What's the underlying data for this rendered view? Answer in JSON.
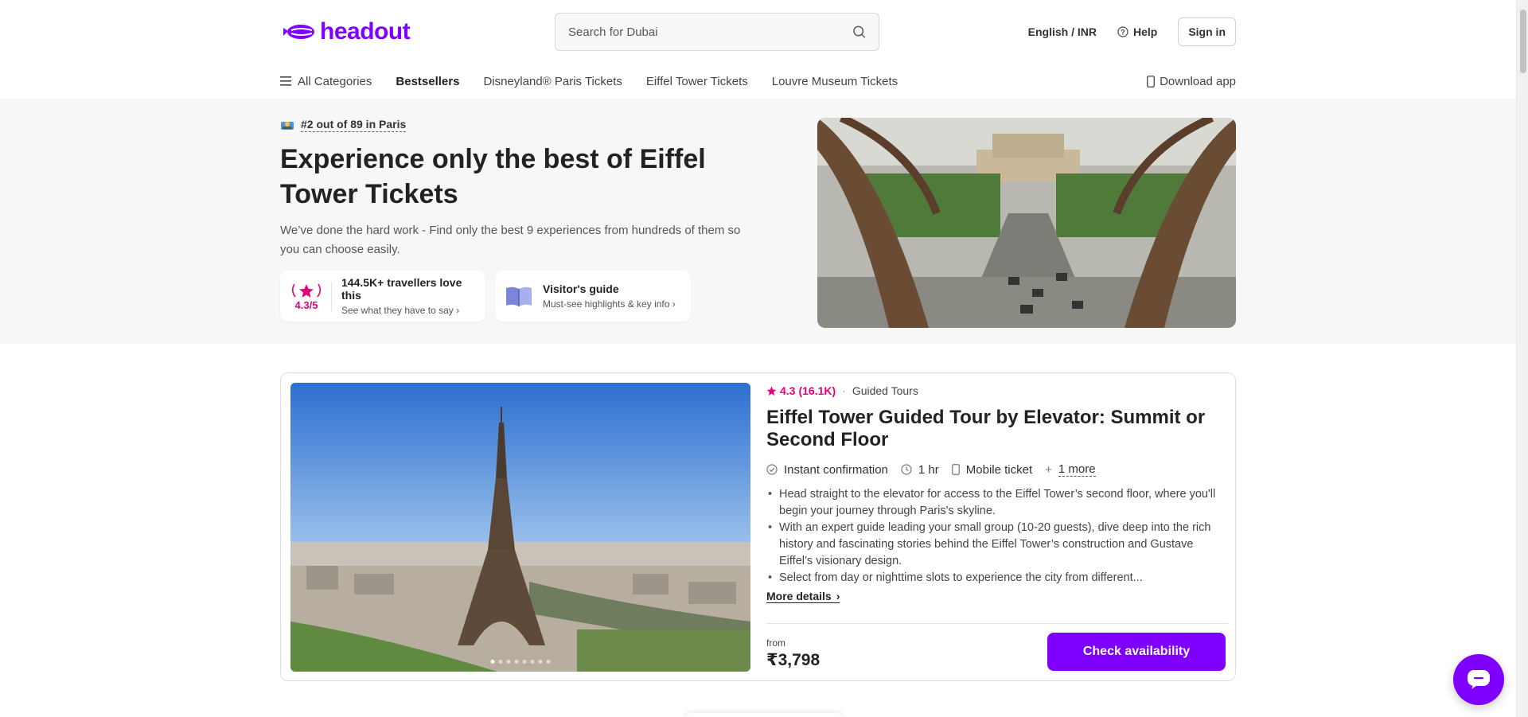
{
  "brand": {
    "name": "headout",
    "accent": "#8000ff",
    "pink": "#e5007a"
  },
  "search": {
    "placeholder": "Search for Dubai"
  },
  "header": {
    "language": "English / INR",
    "help": "Help",
    "signin": "Sign in"
  },
  "nav": {
    "all_categories": "All Categories",
    "items": [
      "Bestsellers",
      "Disneyland® Paris Tickets",
      "Eiffel Tower Tickets",
      "Louvre Museum Tickets"
    ],
    "download": "Download app"
  },
  "hero": {
    "rank": "#2 out of 89 in Paris",
    "title": "Experience only the best of Eiffel Tower Tickets",
    "subtitle": "We’ve done the hard work - Find only the best 9 experiences from hundreds of them so you can choose easily.",
    "rating_value": "4.3/5",
    "rating_title": "144.5K+ travellers love this",
    "rating_link": "See what they have to say",
    "guide_title": "Visitor's guide",
    "guide_link": "Must-see highlights & key info"
  },
  "product": {
    "rating": "4.3",
    "reviews": "(16.1K)",
    "category": "Guided Tours",
    "title": "Eiffel Tower Guided Tour by Elevator: Summit or Second Floor",
    "features": [
      "Instant confirmation",
      "1 hr",
      "Mobile ticket",
      "1 more"
    ],
    "bullets": [
      "Head straight to the elevator for access to the Eiffel Tower’s second floor, where you'll begin your journey through Paris's skyline.",
      "With an expert guide leading your small group (10-20 guests), dive deep into the rich history and fascinating stories behind the Eiffel Tower’s construction and Gustave Eiffel’s visionary design.",
      "Select from day or nighttime slots to experience the city from different..."
    ],
    "more_details": "More details",
    "from_label": "from",
    "price": "₹3,798",
    "cta": "Check availability"
  }
}
